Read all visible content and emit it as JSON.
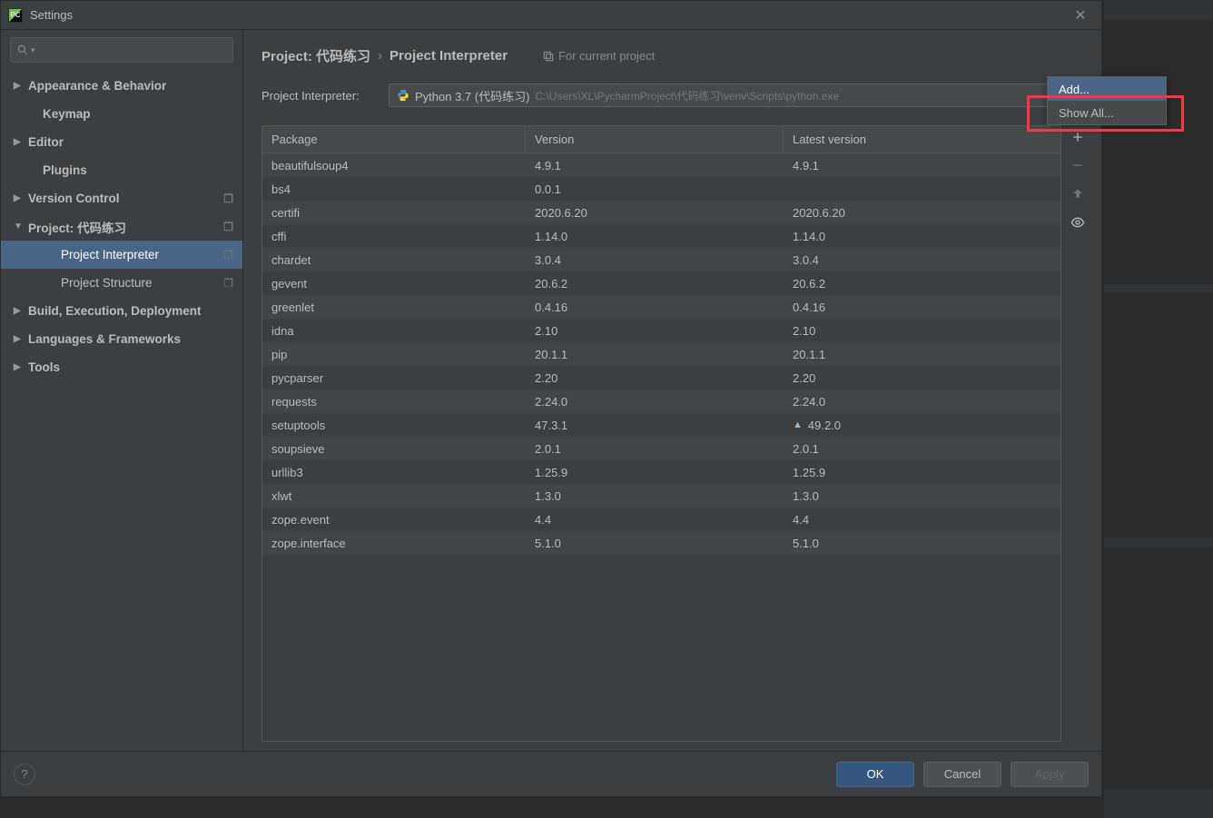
{
  "titlebar": {
    "title": "Settings"
  },
  "search": {
    "placeholder": ""
  },
  "sidebar": {
    "items": [
      {
        "label": "Appearance & Behavior",
        "arrow": "▶",
        "level": 0
      },
      {
        "label": "Keymap",
        "arrow": "",
        "level": 1
      },
      {
        "label": "Editor",
        "arrow": "▶",
        "level": 0
      },
      {
        "label": "Plugins",
        "arrow": "",
        "level": 1
      },
      {
        "label": "Version Control",
        "arrow": "▶",
        "level": 0,
        "copy": true
      },
      {
        "label": "Project: 代码练习",
        "arrow": "▼",
        "level": 0,
        "copy": true
      },
      {
        "label": "Project Interpreter",
        "arrow": "",
        "level": 2,
        "copy": true,
        "selected": true
      },
      {
        "label": "Project Structure",
        "arrow": "",
        "level": 2,
        "copy": true
      },
      {
        "label": "Build, Execution, Deployment",
        "arrow": "▶",
        "level": 0
      },
      {
        "label": "Languages & Frameworks",
        "arrow": "▶",
        "level": 0
      },
      {
        "label": "Tools",
        "arrow": "▶",
        "level": 0
      }
    ]
  },
  "breadcrumb": {
    "a": "Project: 代码练习",
    "b": "Project Interpreter",
    "hint": "For current project"
  },
  "interpreter": {
    "label": "Project Interpreter:",
    "name": "Python 3.7 (代码练习)",
    "path": "C:\\Users\\XL\\PycharmProject\\代码练习\\venv\\Scripts\\python.exe"
  },
  "table": {
    "headers": {
      "pkg": "Package",
      "ver": "Version",
      "lat": "Latest version"
    },
    "rows": [
      {
        "pkg": "beautifulsoup4",
        "ver": "4.9.1",
        "lat": "4.9.1"
      },
      {
        "pkg": "bs4",
        "ver": "0.0.1",
        "lat": ""
      },
      {
        "pkg": "certifi",
        "ver": "2020.6.20",
        "lat": "2020.6.20"
      },
      {
        "pkg": "cffi",
        "ver": "1.14.0",
        "lat": "1.14.0"
      },
      {
        "pkg": "chardet",
        "ver": "3.0.4",
        "lat": "3.0.4"
      },
      {
        "pkg": "gevent",
        "ver": "20.6.2",
        "lat": "20.6.2"
      },
      {
        "pkg": "greenlet",
        "ver": "0.4.16",
        "lat": "0.4.16"
      },
      {
        "pkg": "idna",
        "ver": "2.10",
        "lat": "2.10"
      },
      {
        "pkg": "pip",
        "ver": "20.1.1",
        "lat": "20.1.1"
      },
      {
        "pkg": "pycparser",
        "ver": "2.20",
        "lat": "2.20"
      },
      {
        "pkg": "requests",
        "ver": "2.24.0",
        "lat": "2.24.0"
      },
      {
        "pkg": "setuptools",
        "ver": "47.3.1",
        "lat": "49.2.0",
        "upgrade": true
      },
      {
        "pkg": "soupsieve",
        "ver": "2.0.1",
        "lat": "2.0.1"
      },
      {
        "pkg": "urllib3",
        "ver": "1.25.9",
        "lat": "1.25.9"
      },
      {
        "pkg": "xlwt",
        "ver": "1.3.0",
        "lat": "1.3.0"
      },
      {
        "pkg": "zope.event",
        "ver": "4.4",
        "lat": "4.4"
      },
      {
        "pkg": "zope.interface",
        "ver": "5.1.0",
        "lat": "5.1.0"
      }
    ]
  },
  "popup": {
    "add": "Add...",
    "showAll": "Show All..."
  },
  "footer": {
    "ok": "OK",
    "cancel": "Cancel",
    "apply": "Apply"
  }
}
